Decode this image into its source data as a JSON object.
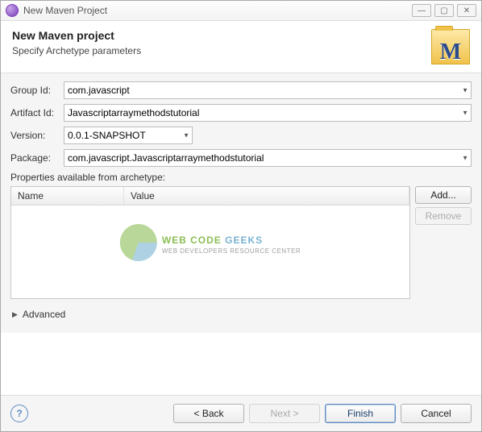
{
  "window": {
    "title": "New Maven Project",
    "controls": {
      "min": "—",
      "max": "▢",
      "close": "✕"
    }
  },
  "header": {
    "title": "New Maven project",
    "subtitle": "Specify Archetype parameters",
    "icon_letter": "M"
  },
  "form": {
    "group_id": {
      "label": "Group Id:",
      "value": "com.javascript"
    },
    "artifact_id": {
      "label": "Artifact Id:",
      "value": "Javascriptarraymethodstutorial"
    },
    "version": {
      "label": "Version:",
      "value": "0.0.1-SNAPSHOT"
    },
    "package": {
      "label": "Package:",
      "value": "com.javascript.Javascriptarraymethodstutorial"
    }
  },
  "properties": {
    "label": "Properties available from archetype:",
    "columns": {
      "name": "Name",
      "value": "Value"
    },
    "rows": [],
    "buttons": {
      "add": "Add...",
      "remove": "Remove"
    }
  },
  "watermark": {
    "main_a": "WEB CODE ",
    "main_b": "GEEKS",
    "sub": "WEB DEVELOPERS RESOURCE CENTER"
  },
  "advanced": {
    "label": "Advanced"
  },
  "footer": {
    "help": "?",
    "buttons": {
      "back": "< Back",
      "next": "Next >",
      "finish": "Finish",
      "cancel": "Cancel"
    }
  }
}
